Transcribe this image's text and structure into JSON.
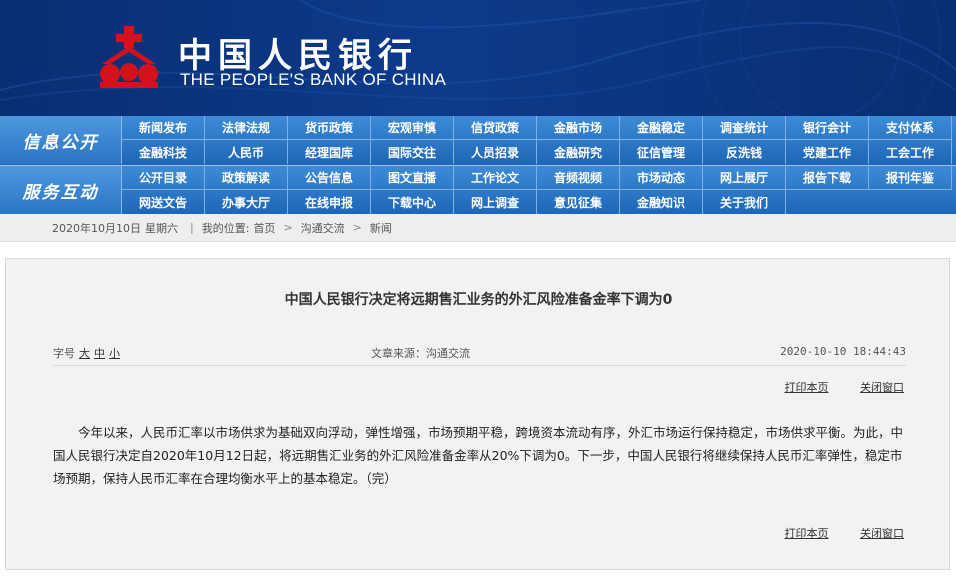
{
  "header": {
    "name_cn": "中国人民银行",
    "name_en": "THE PEOPLE'S BANK OF CHINA",
    "brand_red": "#d4121c",
    "bg_color": "#0c3a8a"
  },
  "nav": {
    "info_title": "信息公开",
    "service_title": "服务互动",
    "info_row1": [
      "新闻发布",
      "法律法规",
      "货币政策",
      "宏观审慎",
      "信贷政策",
      "金融市场",
      "金融稳定",
      "调查统计",
      "银行会计",
      "支付体系"
    ],
    "info_row2": [
      "金融科技",
      "人民币",
      "经理国库",
      "国际交往",
      "人员招录",
      "金融研究",
      "征信管理",
      "反洗钱",
      "党建工作",
      "工会工作"
    ],
    "service_row1": [
      "公开目录",
      "政策解读",
      "公告信息",
      "图文直播",
      "工作论文",
      "音频视频",
      "市场动态",
      "网上展厅",
      "报告下载",
      "报刊年鉴"
    ],
    "service_row2": [
      "网送文告",
      "办事大厅",
      "在线申报",
      "下载中心",
      "网上调查",
      "意见征集",
      "金融知识",
      "关于我们"
    ]
  },
  "breadcrumb": {
    "date": "2020年10月10日",
    "weekday": "星期六",
    "location_label": "我的位置:",
    "home": "首页",
    "level1": "沟通交流",
    "level2": "新闻",
    "sep": ">"
  },
  "article": {
    "title": "中国人民银行决定将远期售汇业务的外汇风险准备金率下调为0",
    "font_label": "字号",
    "font_large": "大",
    "font_medium": "中",
    "font_small": "小",
    "source": "文章来源：沟通交流",
    "date": "2020-10-10 18:44:43",
    "print": "打印本页",
    "close": "关闭窗口",
    "body": "今年以来，人民币汇率以市场供求为基础双向浮动，弹性增强，市场预期平稳，跨境资本流动有序，外汇市场运行保持稳定，市场供求平衡。为此，中国人民银行决定自2020年10月12日起，将远期售汇业务的外汇风险准备金率从20%下调为0。下一步，中国人民银行将继续保持人民币汇率弹性，稳定市场预期，保持人民币汇率在合理均衡水平上的基本稳定。（完）"
  }
}
